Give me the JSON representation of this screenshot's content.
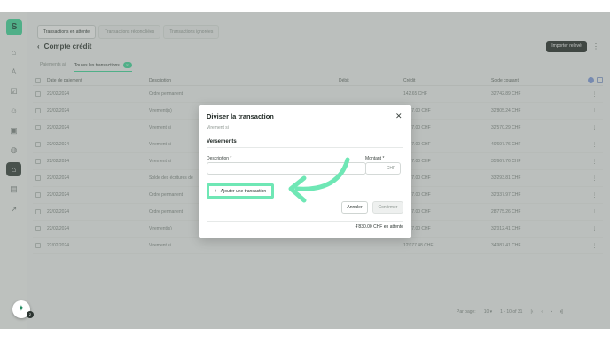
{
  "app": {
    "logo_text": "S",
    "accent_color": "#3bd99a",
    "dark_color": "#1f2623"
  },
  "sidebar": {
    "items": [
      {
        "icon": "home-icon",
        "glyph": "⌂"
      },
      {
        "icon": "users-icon",
        "glyph": "♙"
      },
      {
        "icon": "tasks-icon",
        "glyph": "☑"
      },
      {
        "icon": "user-icon",
        "glyph": "☺"
      },
      {
        "icon": "bag-icon",
        "glyph": "▣"
      },
      {
        "icon": "globe-icon",
        "glyph": "◍"
      },
      {
        "icon": "bank-icon",
        "glyph": "⌂",
        "active": true
      },
      {
        "icon": "document-icon",
        "glyph": "▤"
      },
      {
        "icon": "chart-icon",
        "glyph": "↗"
      }
    ]
  },
  "top_tabs": [
    "Transactions en attente",
    "Transactions réconciliées",
    "Transactions ignorées"
  ],
  "page": {
    "title": "Compte crédit",
    "import_button": "Importer relevé",
    "subtabs": {
      "first": "Paiements ai",
      "second": "Toutes les transactions",
      "second_count": "33"
    }
  },
  "table": {
    "headers": [
      "Date de paiement",
      "Description",
      "Débit",
      "Crédit",
      "Solde courant"
    ],
    "rows": [
      {
        "date": "22/02/2024",
        "desc": "Ordre permanent",
        "debit": "",
        "credit": "142.65 CHF",
        "balance": "32'742.89 CHF"
      },
      {
        "date": "22/02/2024",
        "desc": "Virement(s)",
        "debit": "",
        "credit": "8'477.00 CHF",
        "balance": "32'805.24 CHF"
      },
      {
        "date": "22/02/2024",
        "desc": "Virement si",
        "debit": "",
        "credit": "8'477.00 CHF",
        "balance": "32'570.29 CHF"
      },
      {
        "date": "22/02/2024",
        "desc": "Virement si",
        "debit": "",
        "credit": "8'477.00 CHF",
        "balance": "40'697.76 CHF"
      },
      {
        "date": "22/02/2024",
        "desc": "Virement si",
        "debit": "",
        "credit": "8'477.00 CHF",
        "balance": "35'667.76 CHF"
      },
      {
        "date": "22/02/2024",
        "desc": "Solde des écritures de",
        "debit": "",
        "credit": "8'477.00 CHF",
        "balance": "33'293.81 CHF"
      },
      {
        "date": "22/02/2024",
        "desc": "Ordre permanent",
        "debit": "",
        "credit": "8'477.00 CHF",
        "balance": "32'337.97 CHF"
      },
      {
        "date": "22/02/2024",
        "desc": "Ordre permanent",
        "debit": "",
        "credit": "8'477.00 CHF",
        "balance": "28'775.26 CHF"
      },
      {
        "date": "22/02/2024",
        "desc": "Virement(s)",
        "debit": "",
        "credit": "8'477.00 CHF",
        "balance": "32'012.41 CHF"
      },
      {
        "date": "22/02/2024",
        "desc": "Virement si",
        "debit": "",
        "credit": "12'077.48 CHF",
        "balance": "34'987.41 CHF"
      }
    ]
  },
  "pager": {
    "label": "Par page:",
    "per_page": "10",
    "range": "1 - 10 of 31"
  },
  "chat": {
    "count": "2"
  },
  "modal": {
    "title": "Diviser la transaction",
    "subtitle": "Virement si",
    "section": "Versements",
    "description_label": "Description *",
    "description_value": "",
    "amount_label": "Montant *",
    "amount_currency": "CHF",
    "add_button": "Ajouter une transaction",
    "cancel_button": "Annuler",
    "confirm_button": "Confirmer",
    "pending_text": "4'830.00 CHF en attente",
    "highlight_color": "#6fe7b5"
  }
}
